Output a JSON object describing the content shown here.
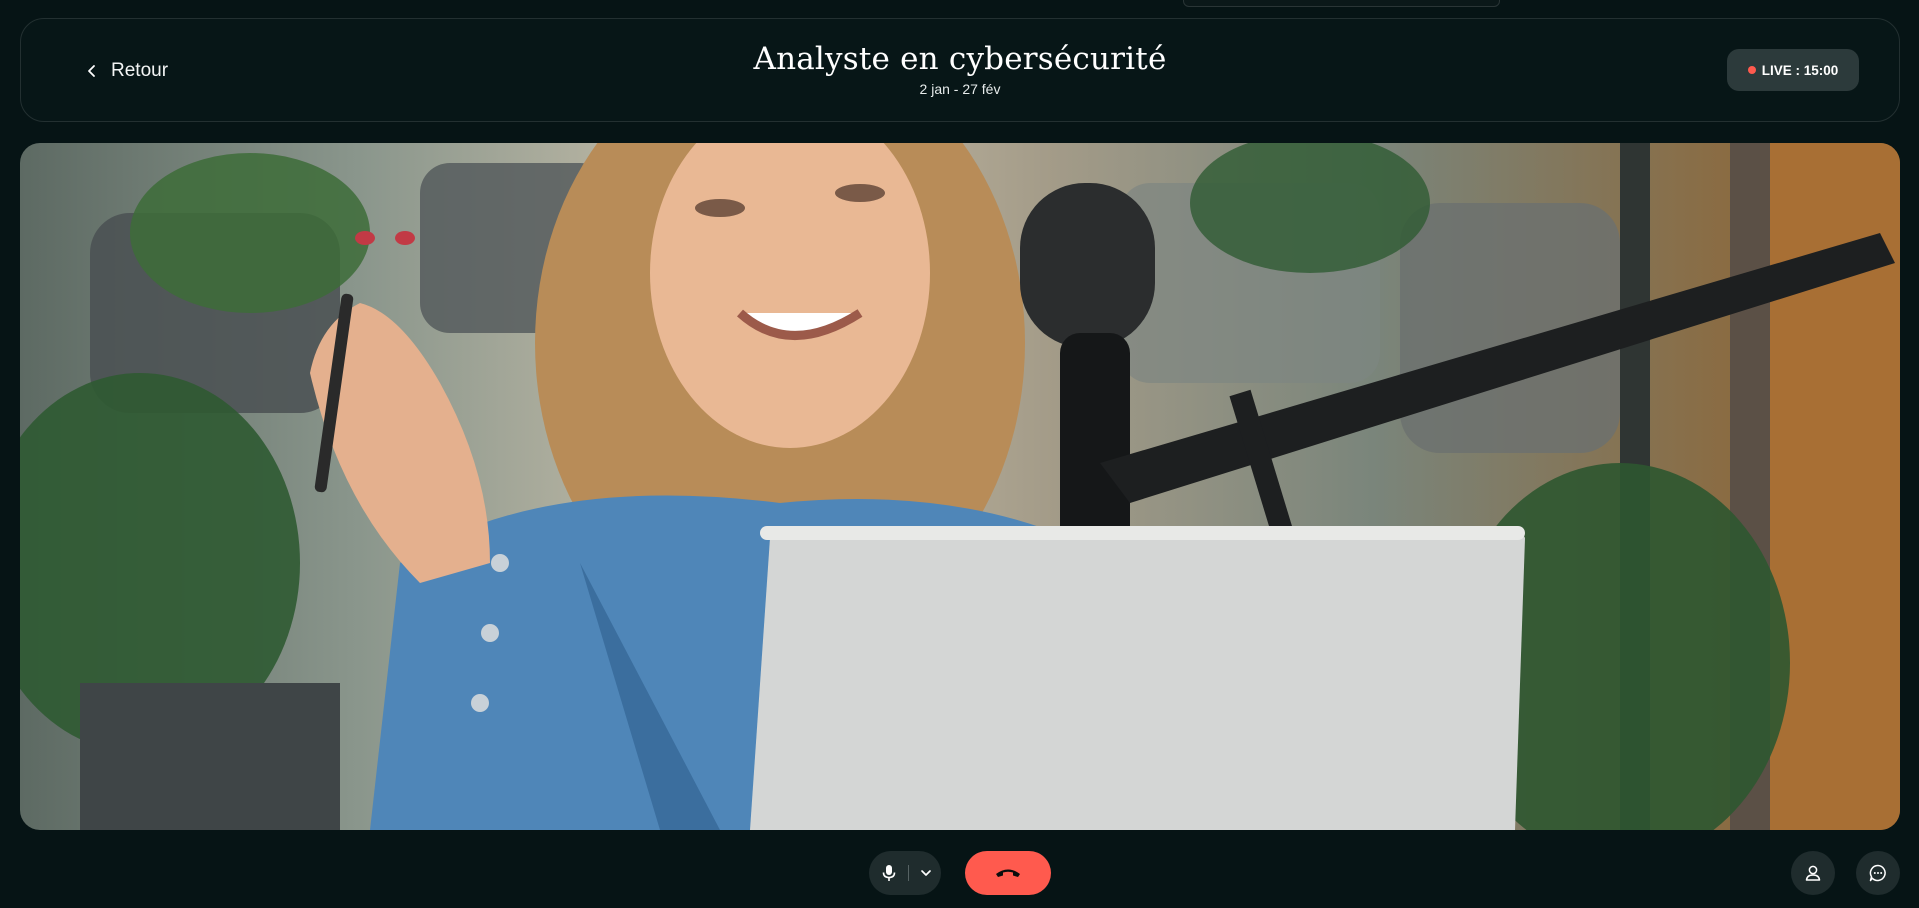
{
  "header": {
    "back_label": "Retour",
    "title": "Analyste en cybersécurité",
    "subtitle": "2 jan - 27 fév",
    "live_label": "LIVE : 15:00"
  },
  "video": {
    "description": "",
    "colors": {
      "status_dot": "#ff5a4e",
      "hangup": "#ff5a4e",
      "background": "#061415"
    }
  },
  "controls": {
    "mic_icon": "microphone-icon",
    "dropdown_icon": "chevron-down-icon",
    "hangup_icon": "phone-hangup-icon",
    "participants_icon": "participants-icon",
    "chat_icon": "chat-bubble-icon"
  }
}
